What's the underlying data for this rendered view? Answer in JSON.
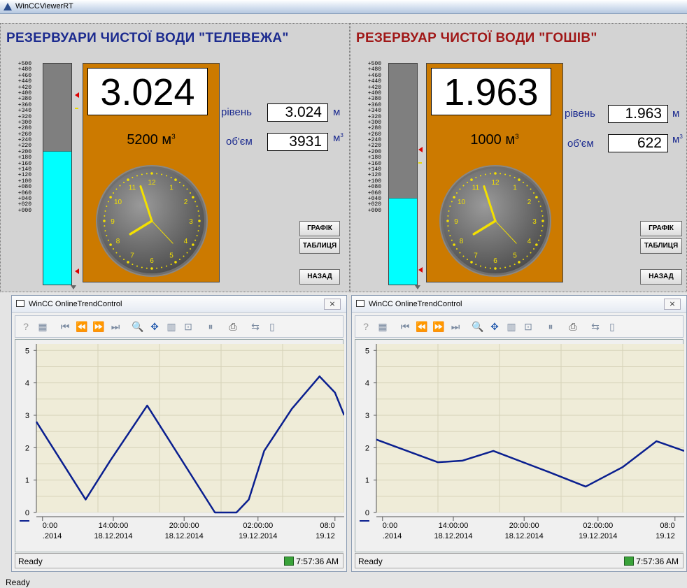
{
  "window": {
    "title": "WinCCViewerRT"
  },
  "scale_labels": [
    "+500",
    "+480",
    "+460",
    "+440",
    "+420",
    "+400",
    "+380",
    "+360",
    "+340",
    "+320",
    "+300",
    "+280",
    "+260",
    "+240",
    "+220",
    "+200",
    "+180",
    "+160",
    "+140",
    "+120",
    "+100",
    "+080",
    "+060",
    "+040",
    "+020",
    "+000"
  ],
  "left": {
    "title": "РЕЗЕРВУАРИ ЧИСТОЇ ВОДИ \"ТЕЛЕВЕЖА\"",
    "title_color": "#1c2b8f",
    "tank_fill_fraction": 0.605,
    "big_value": "3.024",
    "capacity": "5200 м",
    "capacity_sup": "3",
    "level_label": "рівень",
    "level_value": "3.024",
    "level_unit": "м",
    "volume_label": "об'єм",
    "volume_value": "3931",
    "volume_unit": "м",
    "volume_unit_sup": "3",
    "btn_graph": "ГРАФІК",
    "btn_table": "ТАБЛИЦЯ",
    "btn_back": "НАЗАД"
  },
  "right": {
    "title": "РЕЗЕРВУАР ЧИСТОЇ ВОДИ \"ГОШІВ\"",
    "title_color": "#a01818",
    "tank_fill_fraction": 0.393,
    "big_value": "1.963",
    "capacity": "1000 м",
    "capacity_sup": "3",
    "level_label": "рівень",
    "level_value": "1.963",
    "level_unit": "м",
    "volume_label": "об'єм",
    "volume_value": "622",
    "volume_unit": "м",
    "volume_unit_sup": "3",
    "btn_graph": "ГРАФІК",
    "btn_table": "ТАБЛИЦЯ",
    "btn_back": "НАЗАД"
  },
  "clock": {
    "numbers": [
      "12",
      "1",
      "2",
      "3",
      "4",
      "5",
      "6",
      "7",
      "8",
      "9",
      "10",
      "11"
    ],
    "time": "7:57"
  },
  "trend_left": {
    "title": "WinCC OnlineTrendControl",
    "close": "⨯",
    "status": "Ready",
    "time": "7:57:36 AM"
  },
  "trend_right": {
    "title": "WinCC OnlineTrendControl",
    "close": "⨯",
    "status": "Ready",
    "time": "7:57:36 AM"
  },
  "toolbar_icons": [
    "help-icon",
    "config-icon",
    "first-icon",
    "prev-icon",
    "next-icon",
    "last-icon",
    "zoom-icon",
    "move-icon",
    "ruler-icon",
    "original-view-icon",
    "pause-icon",
    "print-icon",
    "export-icon",
    "more-icon"
  ],
  "app_status": "Ready",
  "chart_data": [
    {
      "type": "line",
      "ylim": [
        0,
        5.2
      ],
      "y_ticks": [
        "0",
        "1",
        "2",
        "3",
        "4",
        "5"
      ],
      "x_tick_labels": [
        {
          "time": "0:00",
          "date": ".2014"
        },
        {
          "time": "14:00:00",
          "date": "18.12.2014"
        },
        {
          "time": "20:00:00",
          "date": "18.12.2014"
        },
        {
          "time": "02:00:00",
          "date": "19.12.2014"
        },
        {
          "time": "08:0",
          "date": "19.12"
        }
      ],
      "x": [
        0,
        0.08,
        0.16,
        0.24,
        0.36,
        0.44,
        0.58,
        0.65,
        0.69,
        0.74,
        0.83,
        0.92,
        0.97,
        1.0
      ],
      "y": [
        2.8,
        1.6,
        0.4,
        1.6,
        3.3,
        2.1,
        0.0,
        0.0,
        0.4,
        1.9,
        3.2,
        4.2,
        3.7,
        3.0
      ],
      "x_domain": [
        0,
        1
      ],
      "color": "#0a1f8f"
    },
    {
      "type": "line",
      "ylim": [
        0,
        5.2
      ],
      "y_ticks": [
        "0",
        "1",
        "2",
        "3",
        "4",
        "5"
      ],
      "x_tick_labels": [
        {
          "time": "0:00",
          "date": ".2014"
        },
        {
          "time": "14:00:00",
          "date": "18.12.2014"
        },
        {
          "time": "20:00:00",
          "date": "18.12.2014"
        },
        {
          "time": "02:00:00",
          "date": "19.12.2014"
        },
        {
          "time": "08:0",
          "date": "19.12"
        }
      ],
      "x": [
        0,
        0.2,
        0.28,
        0.38,
        0.56,
        0.68,
        0.8,
        0.91,
        1.0
      ],
      "y": [
        2.25,
        1.55,
        1.6,
        1.9,
        1.25,
        0.8,
        1.4,
        2.2,
        1.9
      ],
      "x_domain": [
        0,
        1
      ],
      "color": "#0a1f8f"
    }
  ]
}
